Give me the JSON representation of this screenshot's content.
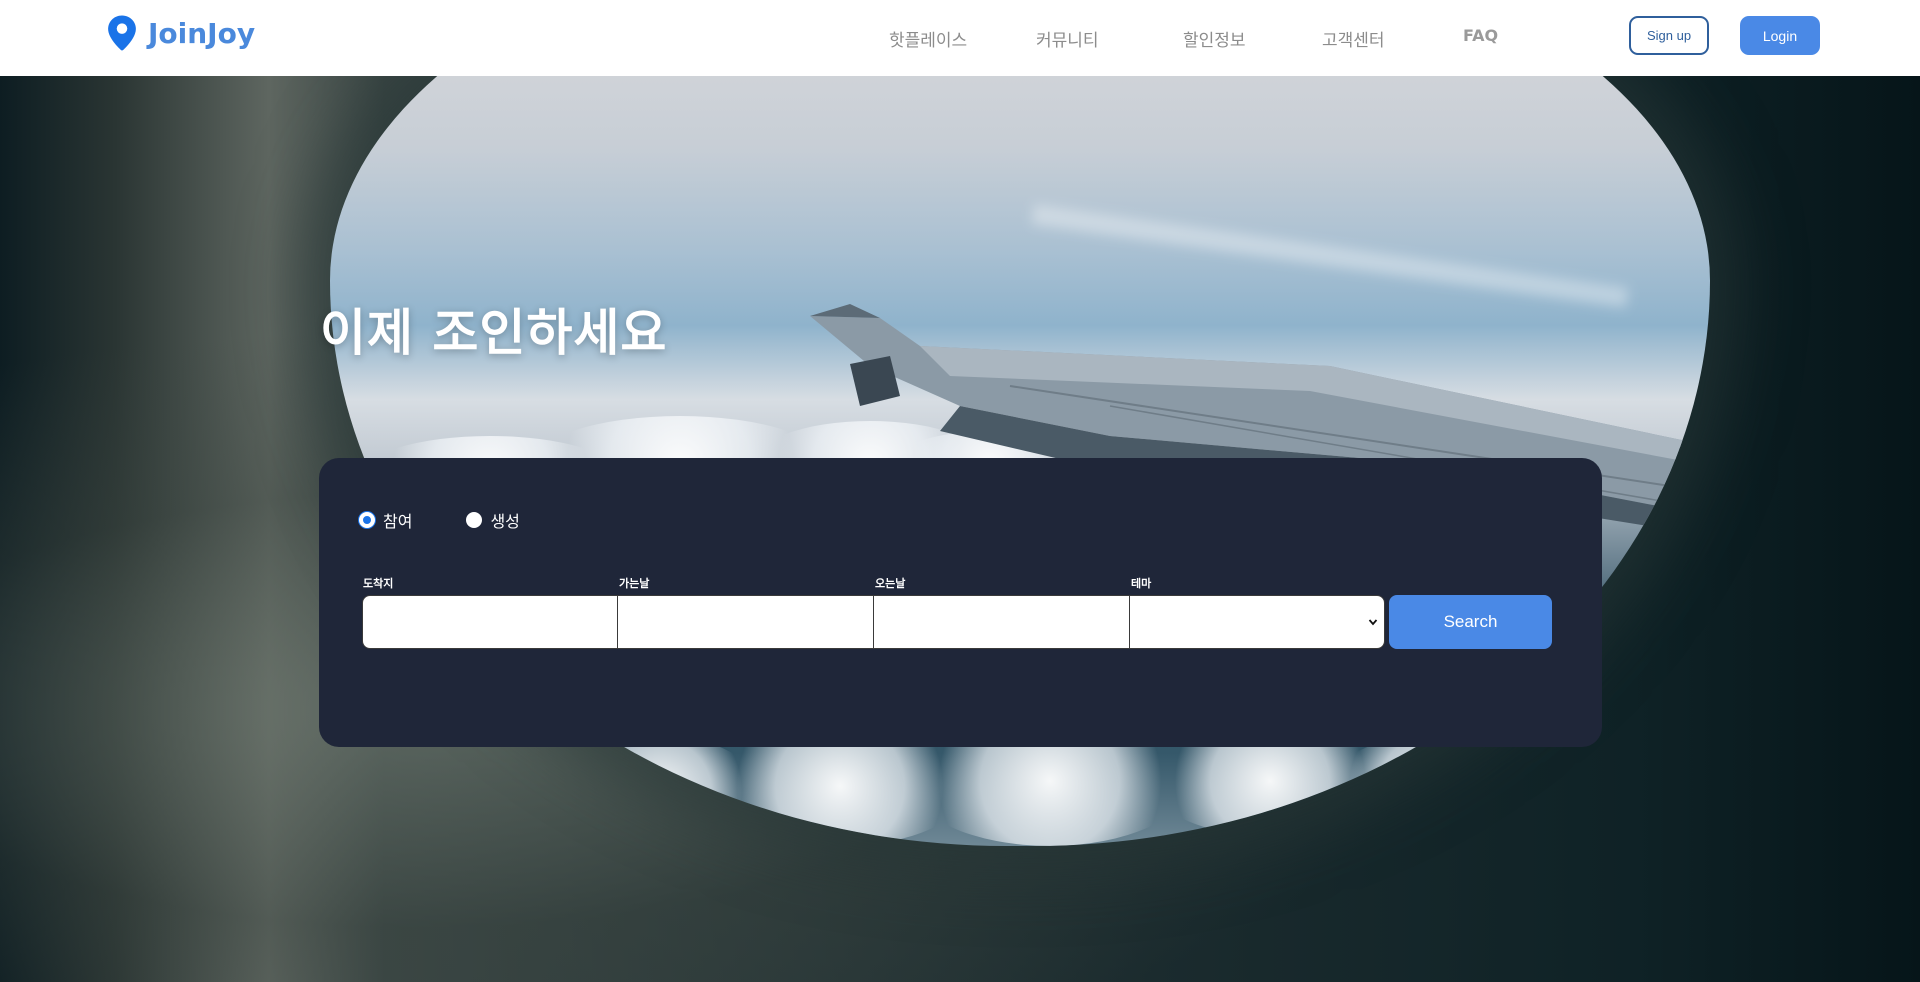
{
  "brand": {
    "name": "JoinJoy",
    "color": "#4a89dc",
    "logo_icon": "map-pin-icon"
  },
  "nav": {
    "items": [
      {
        "label": "핫플레이스"
      },
      {
        "label": "커뮤니티"
      },
      {
        "label": "할인정보"
      },
      {
        "label": "고객센터"
      },
      {
        "label": "FAQ"
      }
    ],
    "signup_label": "Sign up",
    "login_label": "Login"
  },
  "hero": {
    "title": "이제 조인하세요",
    "background": "airplane-window-wing-view"
  },
  "search": {
    "mode_options": [
      {
        "label": "참여",
        "checked": true
      },
      {
        "label": "생성",
        "checked": false
      }
    ],
    "fields": {
      "destination": {
        "label": "도착지",
        "value": ""
      },
      "depart_date": {
        "label": "가는날",
        "value": ""
      },
      "return_date": {
        "label": "오는날",
        "value": ""
      },
      "theme": {
        "label": "테마",
        "selected": ""
      }
    },
    "search_label": "Search"
  },
  "colors": {
    "accent": "#4a89e6",
    "panel": "#1f2639",
    "signup_border": "#2f5f9c"
  }
}
